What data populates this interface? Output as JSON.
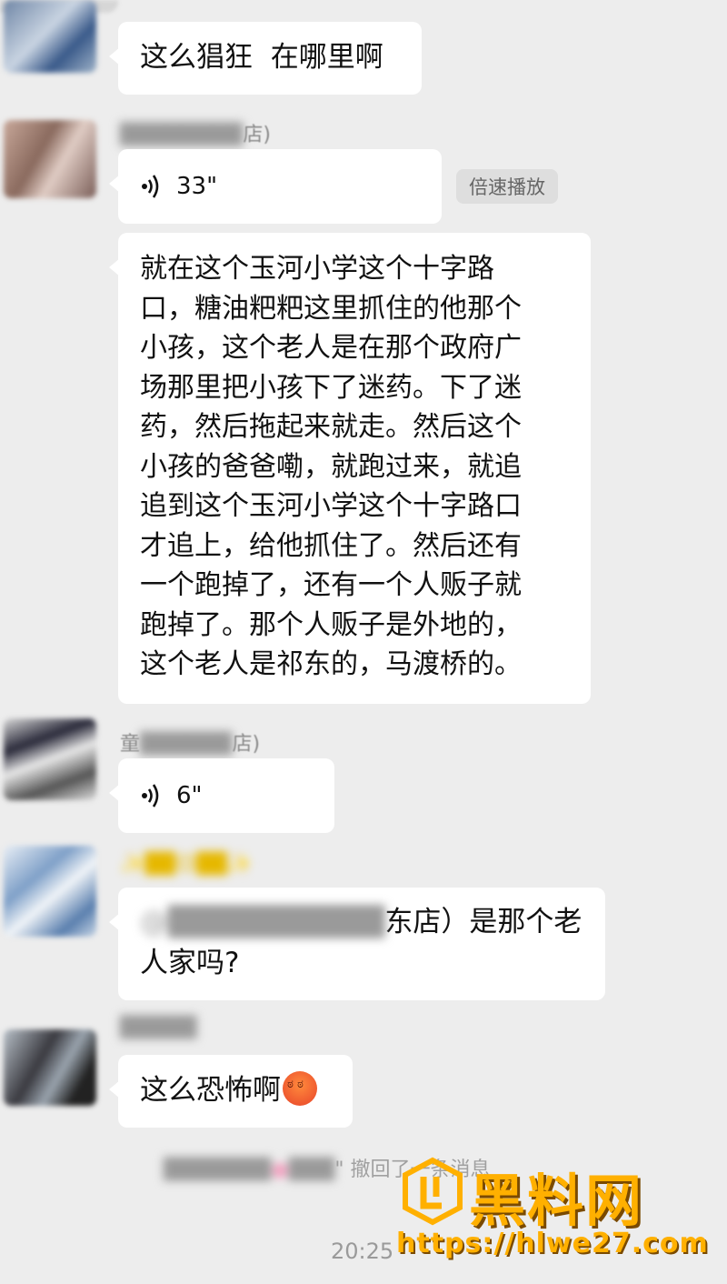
{
  "messages": [
    {
      "text": "这么猖狂  在哪里啊"
    },
    {
      "sender_suffix": "店)",
      "voice_duration": "33\"",
      "speed_button": "倍速播放"
    },
    {
      "transcript": "就在这个玉河小学这个十字路\n口，糖油粑粑这里抓住的他那个\n小孩，这个老人是在那个政府广\n场那里把小孩下了迷药。下了迷\n药，然后拖起来就走。然后这个\n小孩的爸爸嘞，就跑过来，就追\n追到这个玉河小学这个十字路口\n才追上，给他抓住了。然后还有\n一个跑掉了，还有一个人贩子就\n跑掉了。那个人贩子是外地的，\n这个老人是祁东的，马渡桥的。"
    },
    {
      "sender_prefix": "童",
      "sender_suffix": "店)",
      "voice_duration": "6\""
    },
    {
      "text_visible": "东店）是那个老\n人家吗?"
    },
    {
      "text": "这么恐怖啊",
      "emoji": "angry-face"
    }
  ],
  "system": {
    "recall_text": "\" 撤回了一条消息",
    "time": "20:25"
  },
  "watermark": {
    "title": "黑料网",
    "url": "https://hlwe27.com"
  },
  "colors": {
    "background": "#ededed",
    "bubble": "#ffffff",
    "watermark": "#ffb000"
  }
}
